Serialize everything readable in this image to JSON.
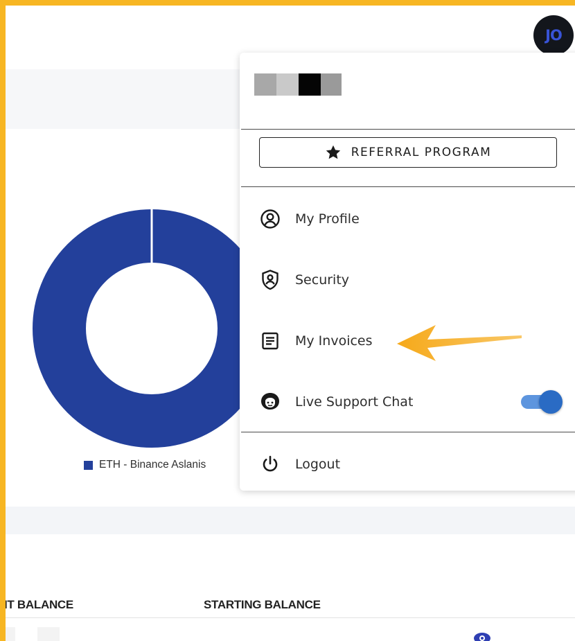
{
  "header": {
    "avatar_initials": "JO"
  },
  "chart_data": {
    "type": "pie",
    "donut": true,
    "slices": [
      {
        "label": "ETH - Binance Aslanis",
        "value": 100,
        "color": "#23409b"
      }
    ],
    "legend": [
      "ETH - Binance Aslanis"
    ],
    "legend_position": "bottom"
  },
  "table": {
    "columns": [
      "IT BALANCE",
      "STARTING BALANCE"
    ]
  },
  "menu": {
    "referral_label": "REFERRAL PROGRAM",
    "items": [
      {
        "label": "My Profile",
        "icon": "user-circle-icon"
      },
      {
        "label": "Security",
        "icon": "shield-user-icon"
      },
      {
        "label": "My Invoices",
        "icon": "invoice-icon"
      },
      {
        "label": "Live Support Chat",
        "icon": "support-chat-icon",
        "toggle_on": true
      },
      {
        "label": "Logout",
        "icon": "power-icon"
      }
    ]
  },
  "colors": {
    "accent": "#23409b",
    "frame": "#f7b623",
    "arrow": "#f7a823",
    "toggle": "#2a6bc4"
  }
}
